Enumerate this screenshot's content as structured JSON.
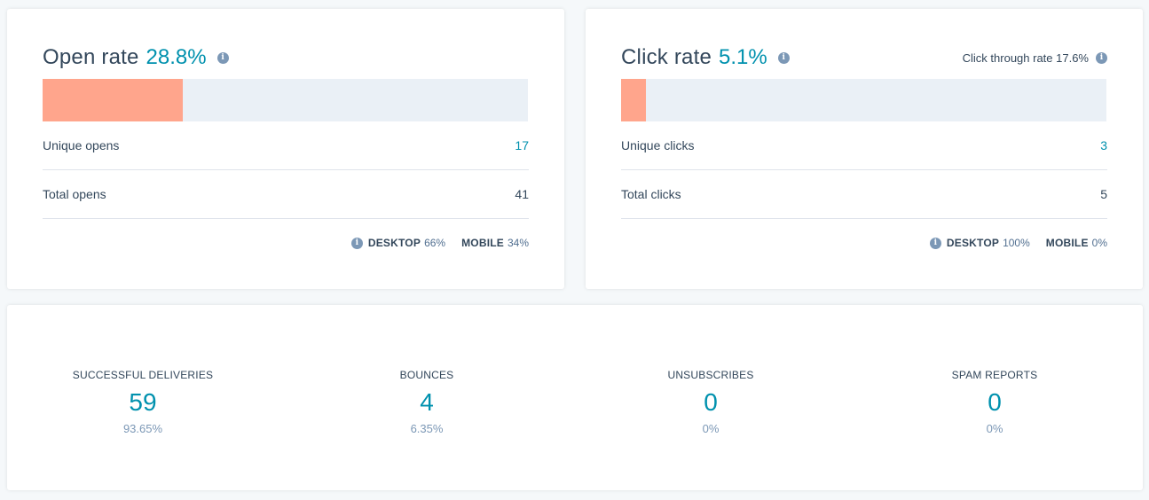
{
  "open_rate": {
    "title": "Open rate",
    "value": "28.8%",
    "bar_fraction": 0.288,
    "rows": [
      {
        "label": "Unique opens",
        "value": "17",
        "link": true
      },
      {
        "label": "Total opens",
        "value": "41",
        "link": false
      }
    ],
    "devices": [
      {
        "label": "DESKTOP",
        "pct": "66%"
      },
      {
        "label": "MOBILE",
        "pct": "34%"
      }
    ]
  },
  "click_rate": {
    "title": "Click rate",
    "value": "5.1%",
    "bar_fraction": 0.051,
    "ctr_text": "Click through rate 17.6%",
    "rows": [
      {
        "label": "Unique clicks",
        "value": "3",
        "link": true
      },
      {
        "label": "Total clicks",
        "value": "5",
        "link": false
      }
    ],
    "devices": [
      {
        "label": "DESKTOP",
        "pct": "100%"
      },
      {
        "label": "MOBILE",
        "pct": "0%"
      }
    ]
  },
  "delivery": {
    "stats": [
      {
        "label": "SUCCESSFUL DELIVERIES",
        "value": "59",
        "pct": "93.65%"
      },
      {
        "label": "BOUNCES",
        "value": "4",
        "pct": "6.35%"
      },
      {
        "label": "UNSUBSCRIBES",
        "value": "0",
        "pct": "0%"
      },
      {
        "label": "SPAM REPORTS",
        "value": "0",
        "pct": "0%"
      }
    ]
  },
  "colors": {
    "accent": "#0091ae",
    "bar_fill": "#ffa58c",
    "bar_track": "#eaf0f6",
    "text": "#33475b",
    "muted": "#7c98b6"
  },
  "icons": {
    "info": "info-icon"
  },
  "info_glyph": "i"
}
